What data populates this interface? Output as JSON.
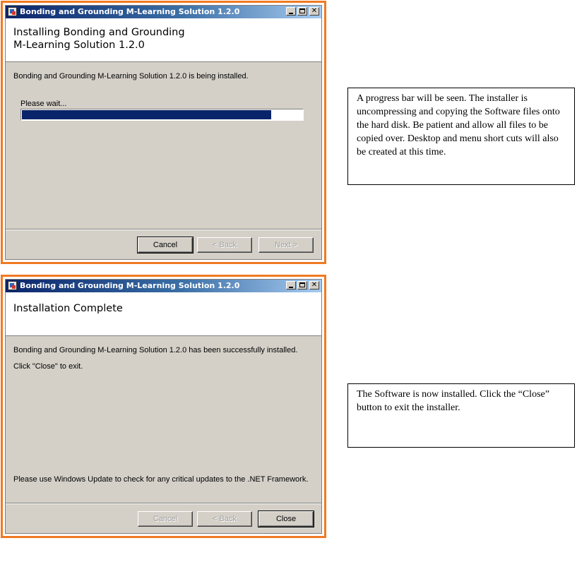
{
  "window_title": "Bonding and Grounding M-Learning Solution 1.2.0",
  "installing_dialog": {
    "header_title_line1": "Installing Bonding and Grounding",
    "header_title_line2": "M-Learning Solution 1.2.0",
    "status_message": "Bonding and Grounding M-Learning Solution 1.2.0 is being installed.",
    "progress_label": "Please wait...",
    "progress_fraction": 0.89,
    "buttons": {
      "cancel": "Cancel",
      "back": "< Back",
      "next": "Next >"
    }
  },
  "complete_dialog": {
    "header_title": "Installation Complete",
    "success_message": "Bonding and Grounding M-Learning Solution 1.2.0 has been successfully installed.",
    "instruction": "Click \"Close\" to exit.",
    "update_note": "Please use Windows Update to check for any critical updates to the .NET Framework.",
    "buttons": {
      "cancel": "Cancel",
      "back": "< Back",
      "close": "Close"
    }
  },
  "callouts": {
    "installing": "A progress bar will be seen. The installer is uncompressing and copying the Software files onto the hard disk. Be patient and allow all files to be copied over. Desktop and menu short cuts will also be created at this time.",
    "complete": "The Software is now installed. Click the “Close” button to exit the installer."
  },
  "colors": {
    "frame_border": "#f07a22",
    "titlebar_start": "#0a246a",
    "titlebar_end": "#a6caf0",
    "dialog_face": "#d4d0c8",
    "progress_fill": "#0a246a"
  },
  "icons": {
    "app": "installer-app-icon",
    "minimize": "minimize-icon",
    "maximize": "maximize-icon",
    "close": "close-x-icon"
  }
}
